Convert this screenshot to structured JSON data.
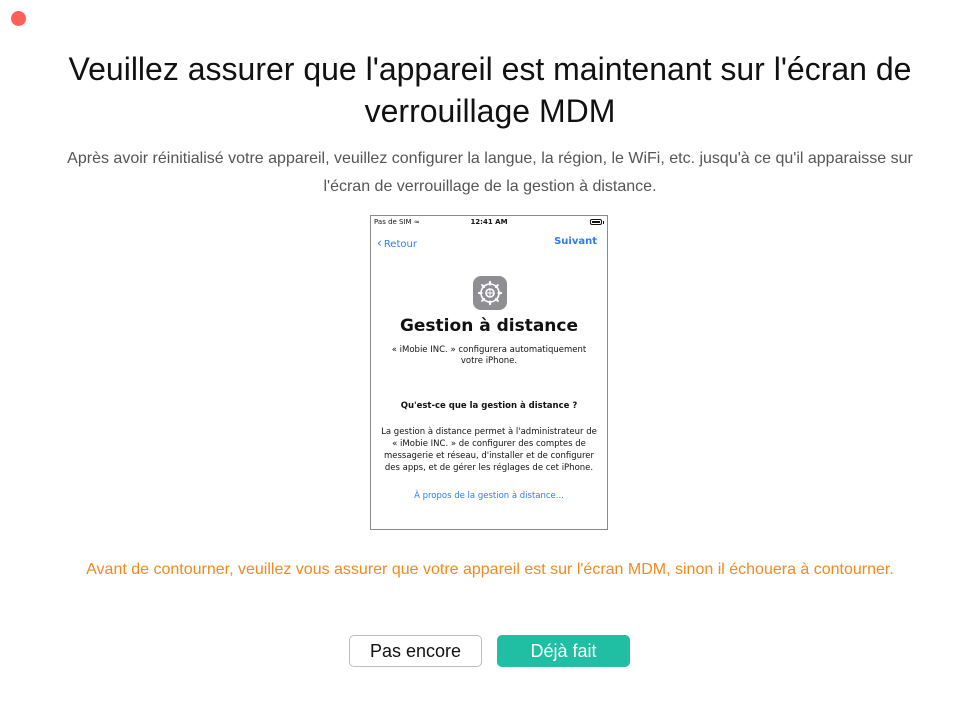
{
  "window": {
    "close_color": "#ff5f57"
  },
  "title": "Veuillez assurer que l'appareil est maintenant sur l'écran de verrouillage MDM",
  "description": "Après avoir réinitialisé votre appareil, veuillez configurer la langue, la région, le WiFi, etc. jusqu'à ce qu'il apparaisse sur l'écran de verrouillage de la gestion à distance.",
  "phone": {
    "status": {
      "carrier": "Pas de SIM",
      "time": "12:41 AM"
    },
    "nav": {
      "back_label": "Retour",
      "next_label": "Suivant"
    },
    "icon": "settings-gear-icon",
    "title": "Gestion à distance",
    "subtitle": "« iMobie INC. » configurera automatiquement votre iPhone.",
    "question": "Qu'est-ce que la gestion à distance ?",
    "body": "La gestion à distance permet à l'administrateur de « iMobie INC. » de configurer des comptes de messagerie et réseau, d'installer et de configurer des apps, et de gérer les réglages de cet iPhone.",
    "link": "À propos de la gestion à distance..."
  },
  "warning": "Avant de contourner, veuillez vous assurer que votre appareil est sur l'écran MDM, sinon il échouera à contourner.",
  "buttons": {
    "not_yet": "Pas encore",
    "done": "Déjà fait"
  },
  "colors": {
    "accent": "#20bfa4",
    "warning": "#f28a1e",
    "link": "#2e7bf6"
  }
}
